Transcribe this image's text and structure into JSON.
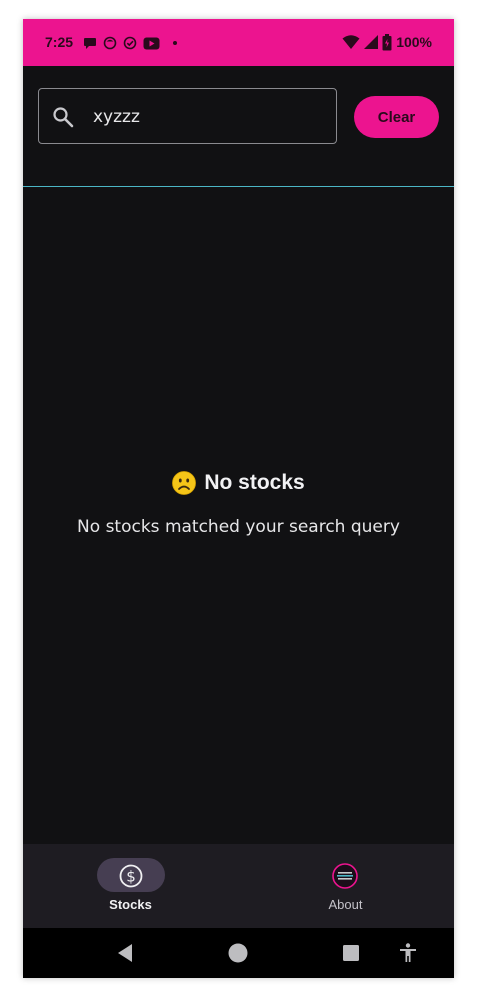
{
  "status_bar": {
    "time": "7:25",
    "battery": "100%",
    "background": "#ec148f",
    "left_icons": [
      "chat-bubble-icon",
      "face-icon",
      "check-circle-icon",
      "youtube-icon",
      "dot-icon"
    ],
    "right_icons": [
      "wifi-icon",
      "cell-signal-icon",
      "battery-icon"
    ]
  },
  "search": {
    "icon": "search-icon",
    "value": "xyzzz",
    "clear_label": "Clear"
  },
  "empty_state": {
    "emoji": "sad-face-icon",
    "title": "No stocks",
    "message": "No stocks matched your search query"
  },
  "bottom_nav": {
    "items": [
      {
        "label": "Stocks",
        "icon": "dollar-circle-icon",
        "selected": true
      },
      {
        "label": "About",
        "icon": "about-logo-icon",
        "selected": false
      }
    ]
  },
  "system_nav": {
    "buttons": [
      "back-icon",
      "home-icon",
      "recents-icon",
      "accessibility-icon"
    ]
  },
  "colors": {
    "accent": "#ec148f",
    "background": "#111113",
    "divider": "#4bb6c5",
    "nav_background": "#1e1c22",
    "nav_pill": "#463e52"
  }
}
